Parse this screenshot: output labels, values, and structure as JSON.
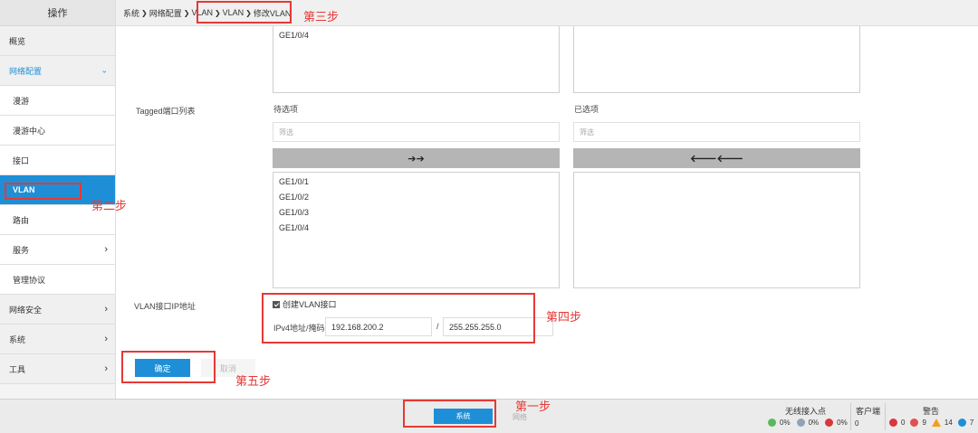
{
  "sidebar": {
    "header": "操作",
    "items": [
      {
        "label": "概览"
      },
      {
        "label": "网络配置",
        "chevron": "⌄"
      },
      {
        "label": "漫游"
      },
      {
        "label": "漫游中心"
      },
      {
        "label": "接口"
      },
      {
        "label": "VLAN"
      },
      {
        "label": "路由"
      },
      {
        "label": "服务",
        "chevron": "›"
      },
      {
        "label": "管理协议"
      },
      {
        "label": "网络安全",
        "chevron": "›"
      },
      {
        "label": "系统",
        "chevron": "›"
      },
      {
        "label": "工具",
        "chevron": "›"
      }
    ]
  },
  "breadcrumb": {
    "items": [
      "系统",
      "网络配置",
      "VLAN",
      "VLAN",
      "修改VLAN"
    ],
    "separator": "❯"
  },
  "untagged": {
    "available_items": [
      "GE1/0/4"
    ]
  },
  "tagged": {
    "label": "Tagged端口列表",
    "available_title": "待选项",
    "selected_title": "已选项",
    "filter_placeholder": "筛选",
    "move_right": "➔➔",
    "move_left": "🡐🡐",
    "available_items": [
      "GE1/0/1",
      "GE1/0/2",
      "GE1/0/3",
      "GE1/0/4"
    ]
  },
  "vlan_if": {
    "label": "VLAN接口IP地址",
    "checkbox_label": "创建VLAN接口",
    "ip_label": "IPv4地址/掩码",
    "ip_value": "192.168.200.2",
    "slash": "/",
    "mask_value": "255.255.255.0"
  },
  "actions": {
    "ok": "确定",
    "cancel": "取消"
  },
  "steps": {
    "s1": "第一步",
    "s2": "第二步",
    "s3": "第三步",
    "s4": "第四步",
    "s5": "第五步"
  },
  "footer": {
    "system_button": "系统",
    "network_tab": "网络",
    "ap_title": "无线接入点",
    "ap_green": "0%",
    "ap_gray": "0%",
    "ap_red": "0%",
    "client_title": "客户端",
    "client_count": "0",
    "alarm_title": "警告",
    "alarm_critical": "0",
    "alarm_major": "9",
    "alarm_minor": "14",
    "alarm_info": "7"
  },
  "colors": {
    "accent": "#1e8fd6",
    "annotation": "#e53935"
  }
}
